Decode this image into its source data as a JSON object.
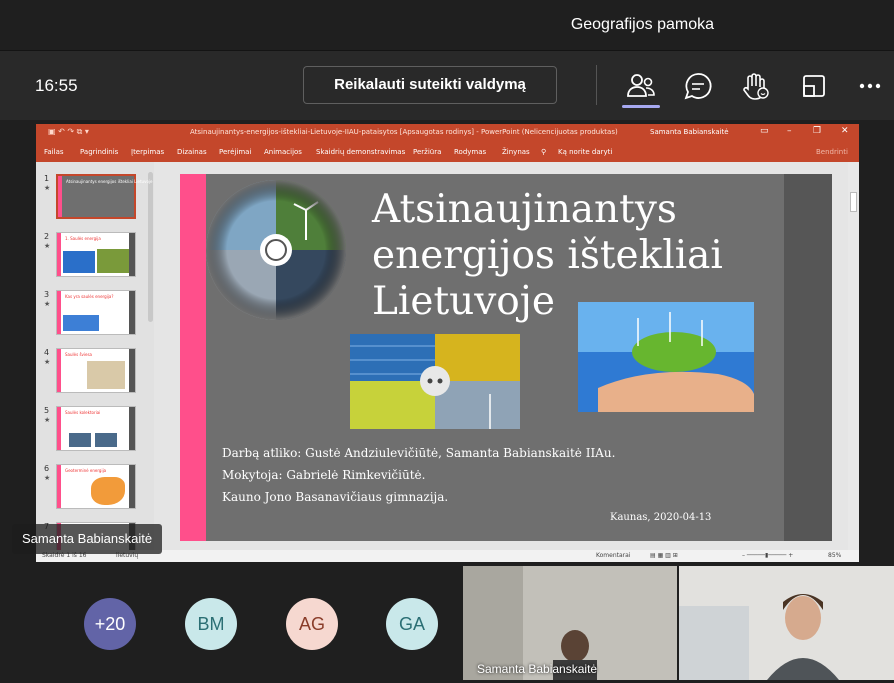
{
  "meeting": {
    "title": "Geografijos pamoka",
    "time": "16:55",
    "request_control_label": "Reikalauti suteikti valdymą"
  },
  "controls": [
    {
      "name": "people-icon"
    },
    {
      "name": "chat-icon"
    },
    {
      "name": "raise-hand-icon"
    },
    {
      "name": "rooms-icon"
    },
    {
      "name": "more-icon"
    }
  ],
  "powerpoint": {
    "doc_title": "Atsinaujinantys-energijos-ištekliai-Lietuvoje-IIAU-pataisytos [Apsaugotas rodinys] - PowerPoint (Nelicencijuotas produktas)",
    "user": "Samanta Babianskaitė",
    "tabs": [
      "Failas",
      "Pagrindinis",
      "Įterpimas",
      "Dizainas",
      "Perėjimai",
      "Animacijos",
      "Skaidrių demonstravimas",
      "Peržiūra",
      "Rodymas",
      "Žinynas",
      "Ką norite daryti"
    ],
    "share_label": "Bendrinti",
    "thumbnails": [
      {
        "num": "1",
        "title": "Atsinaujinantys energijos ištekliai Lietuvoje"
      },
      {
        "num": "2",
        "title": "1. Saulės energija"
      },
      {
        "num": "3",
        "title": "Kas yra saulės energija?"
      },
      {
        "num": "4",
        "title": "Saulės šviesa"
      },
      {
        "num": "5",
        "title": "Saulės kolektoriai"
      },
      {
        "num": "6",
        "title": "Geoterminė energija"
      },
      {
        "num": "7",
        "title": ""
      }
    ],
    "status": {
      "slide": "Skaidrė 1 iš 16",
      "lang": "lietuvių",
      "comments": "Komentarai",
      "zoom": "85%"
    }
  },
  "slide": {
    "title_lines": [
      "Atsinaujinantys",
      "energijos ištekliai",
      "Lietuvoje"
    ],
    "author": "Darbą atliko: Gustė Andziulevičiūtė, Samanta Babianskaitė IIAu.",
    "teacher": "Mokytoja: Gabrielė Rimkevičiūtė.",
    "school": "Kauno Jono Basanavičiaus gimnazija.",
    "date": "Kaunas, 2020-04-13"
  },
  "presenter_name": "Samanta Babianskaitė",
  "participants": {
    "more_count": "+20",
    "avatars": [
      {
        "initials": "BM",
        "bg": "#c9e8ea",
        "fg": "#2b6f74"
      },
      {
        "initials": "AG",
        "bg": "#f6d8d0",
        "fg": "#8a3d2a"
      },
      {
        "initials": "GA",
        "bg": "#c9e8ea",
        "fg": "#2b6f74"
      }
    ],
    "more_bg": "#6264a7",
    "video_tiles": [
      {
        "name": "Samanta Babianskaitė"
      }
    ]
  }
}
